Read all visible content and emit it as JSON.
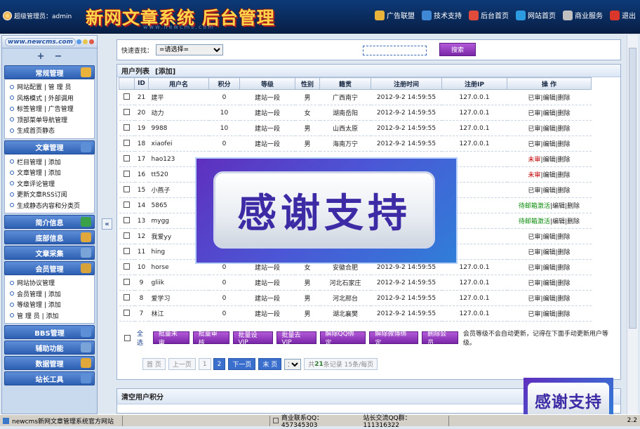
{
  "header": {
    "admin_label": "超级管理员：admin",
    "title": "新网文章系统 后台管理",
    "subtitle": "www.newcms.com",
    "nav": [
      {
        "label": "广告联盟",
        "icon": "ad-league-icon",
        "color": "#e9b23a"
      },
      {
        "label": "技术支持",
        "icon": "tech-support-icon",
        "color": "#3f88d8"
      },
      {
        "label": "后台首页",
        "icon": "admin-home-icon",
        "color": "#e04b3b"
      },
      {
        "label": "网站首页",
        "icon": "site-home-icon",
        "color": "#2c9be0"
      },
      {
        "label": "商业服务",
        "icon": "business-service-icon",
        "color": "#c0c0c0"
      },
      {
        "label": "退出",
        "icon": "logout-icon",
        "color": "#d9362c"
      }
    ]
  },
  "sidebar": {
    "logo": "www.newcms.com",
    "expand": "+",
    "collapse": "−",
    "sections": [
      {
        "title": "常规管理",
        "icon": "settings-icon",
        "rows": [
          "网站配置 | 管 理 员",
          "风格模式 | 外部调用",
          "标签管理 | 广告管理",
          "顶部菜单导航管理",
          "生成首页静态"
        ]
      },
      {
        "title": "文章管理",
        "icon": "article-icon",
        "rows": [
          "栏目管理 | 添加",
          "文章管理 | 添加",
          "文章评论管理",
          "更新文章RSS订阅",
          "生成静态内容和分类页"
        ]
      },
      {
        "title": "简介信息",
        "icon": "intro-icon",
        "rows": []
      },
      {
        "title": "底部信息",
        "icon": "footer-info-icon",
        "rows": []
      },
      {
        "title": "文章采集",
        "icon": "collect-icon",
        "rows": []
      },
      {
        "title": "会员管理",
        "icon": "members-icon",
        "rows": [
          "网站协议管理",
          "会员管理 | 添加",
          "等级管理 | 添加",
          "管 理 员 | 添加"
        ]
      },
      {
        "title": "BBS管理",
        "icon": "bbs-icon",
        "rows": []
      },
      {
        "title": "辅助功能",
        "icon": "tools-icon",
        "rows": []
      },
      {
        "title": "数据管理",
        "icon": "database-icon",
        "rows": []
      },
      {
        "title": "站长工具",
        "icon": "webmaster-icon",
        "rows": []
      }
    ]
  },
  "quick_search": {
    "label": "快速查找：",
    "select_value": "=请选择=",
    "button": "搜索"
  },
  "user_list": {
    "title": "用户列表",
    "add": "[添加]",
    "columns": [
      "ID",
      "用户名",
      "积分",
      "等级",
      "性别",
      "籍贯",
      "注册时间",
      "注册IP",
      "操 作"
    ],
    "rows": [
      {
        "id": "21",
        "name": "建平",
        "points": "0",
        "level": "建站一段",
        "gender": "男",
        "native": "广西南宁",
        "time": "2012-9-2 14:59:55",
        "ip": "127.0.0.1",
        "status": "已审",
        "status_type": "normal"
      },
      {
        "id": "20",
        "name": "动力",
        "points": "10",
        "level": "建站一段",
        "gender": "女",
        "native": "湖南岳阳",
        "time": "2012-9-2 14:59:55",
        "ip": "127.0.0.1",
        "status": "已审",
        "status_type": "normal"
      },
      {
        "id": "19",
        "name": "9988",
        "points": "10",
        "level": "建站一段",
        "gender": "男",
        "native": "山西太原",
        "time": "2012-9-2 14:59:55",
        "ip": "127.0.0.1",
        "status": "已审",
        "status_type": "normal"
      },
      {
        "id": "18",
        "name": "xiaofei",
        "points": "0",
        "level": "建站一段",
        "gender": "男",
        "native": "海南万宁",
        "time": "2012-9-2 14:59:55",
        "ip": "127.0.0.1",
        "status": "已审",
        "status_type": "normal"
      },
      {
        "id": "17",
        "name": "hao123",
        "points": "",
        "level": "",
        "gender": "",
        "native": "",
        "time": "",
        "ip": "",
        "status": "未审",
        "status_type": "red"
      },
      {
        "id": "16",
        "name": "tt520",
        "points": "",
        "level": "",
        "gender": "",
        "native": "",
        "time": "",
        "ip": "",
        "status": "未审",
        "status_type": "red"
      },
      {
        "id": "15",
        "name": "小燕子",
        "points": "",
        "level": "",
        "gender": "",
        "native": "",
        "time": "",
        "ip": "",
        "status": "已审",
        "status_type": "normal"
      },
      {
        "id": "14",
        "name": "5865",
        "points": "",
        "level": "",
        "gender": "",
        "native": "",
        "time": "",
        "ip": "",
        "status": "待邮箱激活",
        "status_type": "green"
      },
      {
        "id": "13",
        "name": "mygg",
        "points": "",
        "level": "",
        "gender": "",
        "native": "",
        "time": "",
        "ip": "",
        "status": "待邮箱激活",
        "status_type": "green"
      },
      {
        "id": "12",
        "name": "我爱yy",
        "points": "",
        "level": "",
        "gender": "",
        "native": "",
        "time": "",
        "ip": "",
        "status": "已审",
        "status_type": "normal"
      },
      {
        "id": "11",
        "name": "hing",
        "points": "",
        "level": "",
        "gender": "",
        "native": "",
        "time": "",
        "ip": "",
        "status": "已审",
        "status_type": "normal"
      },
      {
        "id": "10",
        "name": "horse",
        "points": "0",
        "level": "建站一段",
        "gender": "女",
        "native": "安徽合肥",
        "time": "2012-9-2 14:59:55",
        "ip": "127.0.0.1",
        "status": "已审",
        "status_type": "normal"
      },
      {
        "id": "9",
        "name": "gliik",
        "points": "0",
        "level": "建站一段",
        "gender": "男",
        "native": "河北石家庄",
        "time": "2012-9-2 14:59:55",
        "ip": "127.0.0.1",
        "status": "已审",
        "status_type": "normal"
      },
      {
        "id": "8",
        "name": "爱学习",
        "points": "0",
        "level": "建站一段",
        "gender": "男",
        "native": "河北邢台",
        "time": "2012-9-2 14:59:55",
        "ip": "127.0.0.1",
        "status": "已审",
        "status_type": "normal"
      },
      {
        "id": "7",
        "name": "林江",
        "points": "0",
        "level": "建站一段",
        "gender": "男",
        "native": "湖北襄樊",
        "time": "2012-9-2 14:59:55",
        "ip": "127.0.0.1",
        "status": "已审",
        "status_type": "normal"
      }
    ],
    "edit": "编辑",
    "delete": "删除",
    "sep": "|",
    "select_all": "全选",
    "bulk_buttons": [
      "批量未审",
      "批量审核",
      "批量设VIP",
      "批量去VIP",
      "解除QQ绑定",
      "解除微博绑定",
      "删除会员"
    ],
    "bulk_note": "会员等级不会自动更新，记得在下面手动更新用户等级。",
    "pager": {
      "first": "首 页",
      "prev": "上一页",
      "pages": [
        "1",
        "2"
      ],
      "current": "2",
      "next": "下一页",
      "last": "末 页",
      "select_value": "1",
      "info_prefix": "共",
      "total": "21",
      "info_suffix": "条记录 15条/每页"
    }
  },
  "clear_points": {
    "title": "清空用户积分"
  },
  "overlay": {
    "banner": "感谢支持",
    "small": "感谢支持"
  },
  "statusbar": {
    "left": "newcms新网文章管理系统官方网站",
    "biz_qq": "商业联系QQ：457345303",
    "group": "站长交流QQ群：111316322",
    "right": "2.2"
  }
}
